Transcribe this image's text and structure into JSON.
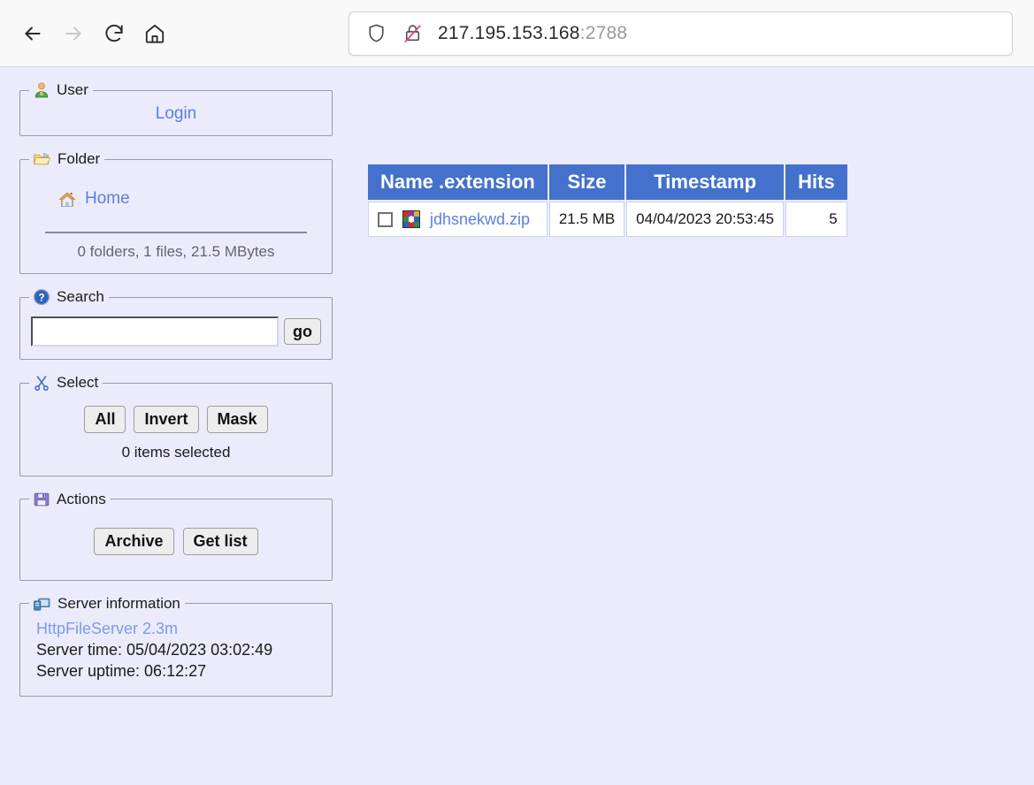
{
  "browser": {
    "back_label": "Back",
    "forward_label": "Forward",
    "reload_label": "Reload",
    "home_label": "Home",
    "shield_label": "Tracking protection",
    "lock_label": "Connection not secure",
    "url_host": "217.195.153.168",
    "url_port": ":2788"
  },
  "sidebar": {
    "user": {
      "legend": "User",
      "login_label": "Login"
    },
    "folder": {
      "legend": "Folder",
      "home_label": "Home",
      "stats": "0 folders, 1 files, 21.5 MBytes"
    },
    "search": {
      "legend": "Search",
      "value": "",
      "placeholder": "",
      "go_label": "go"
    },
    "select": {
      "legend": "Select",
      "all_label": "All",
      "invert_label": "Invert",
      "mask_label": "Mask",
      "count_label": "0 items selected"
    },
    "actions": {
      "legend": "Actions",
      "archive_label": "Archive",
      "getlist_label": "Get list"
    },
    "server": {
      "legend": "Server information",
      "version": "HttpFileServer 2.3m",
      "time": "Server time: 05/04/2023 03:02:49",
      "uptime": "Server uptime: 06:12:27"
    }
  },
  "filelist": {
    "columns": [
      "Name .extension",
      "Size",
      "Timestamp",
      "Hits"
    ],
    "rows": [
      {
        "name": "jdhsnekwd.zip",
        "size": "21.5 MB",
        "timestamp": "04/04/2023 20:53:45",
        "hits": "5",
        "icon": "archive-zip-icon",
        "checked": false
      }
    ]
  },
  "colors": {
    "page_bg": "#ebebfc",
    "header_blue": "#4371cc",
    "link_blue": "#5b7fe0",
    "panel_border": "#9a9aaa"
  }
}
